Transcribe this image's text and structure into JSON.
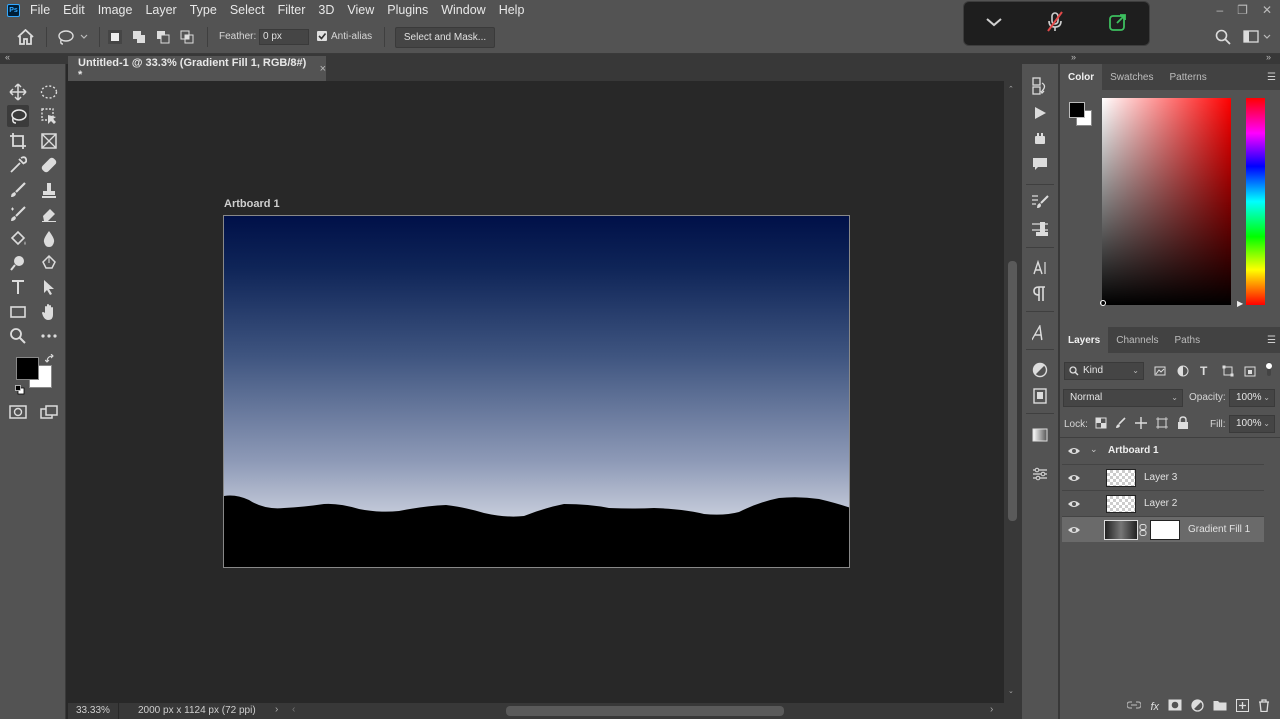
{
  "app": {
    "logo": "Ps",
    "menu": [
      "File",
      "Edit",
      "Image",
      "Layer",
      "Type",
      "Select",
      "Filter",
      "3D",
      "View",
      "Plugins",
      "Window",
      "Help"
    ],
    "window_controls": [
      "–",
      "❐",
      "✕"
    ]
  },
  "options_bar": {
    "feather_label": "Feather:",
    "feather_value": "0 px",
    "antialias_label": "Anti-alias",
    "antialias_checked": true,
    "select_mask_label": "Select and Mask..."
  },
  "document": {
    "tab_title": "Untitled-1 @ 33.3% (Gradient Fill 1, RGB/8#) *",
    "tab_close": "×",
    "artboard_label": "Artboard 1",
    "zoom": "33.33%",
    "doc_info": "2000 px x 1124 px (72 ppi)"
  },
  "color_panel": {
    "tabs": [
      "Color",
      "Swatches",
      "Patterns"
    ],
    "active_tab": "Color",
    "foreground": "#000000",
    "background": "#ffffff"
  },
  "layers_panel": {
    "tabs": [
      "Layers",
      "Channels",
      "Paths"
    ],
    "active_tab": "Layers",
    "filter_label": "Kind",
    "blend_mode": "Normal",
    "opacity_label": "Opacity:",
    "opacity_value": "100%",
    "lock_label": "Lock:",
    "fill_label": "Fill:",
    "fill_value": "100%",
    "layers": [
      {
        "name": "Artboard 1",
        "type": "artboard"
      },
      {
        "name": "Layer 3",
        "type": "pixel"
      },
      {
        "name": "Layer 2",
        "type": "pixel"
      },
      {
        "name": "Gradient Fill 1",
        "type": "fill",
        "selected": true
      }
    ]
  }
}
